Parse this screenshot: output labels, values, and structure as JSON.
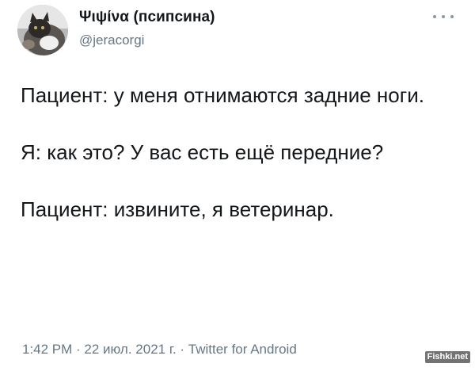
{
  "author": {
    "display_name": "Ψιψίνα (псипсина)",
    "handle": "@jeracorgi"
  },
  "tweet": {
    "paragraphs": [
      "Пациент: у меня отнимаются задние ноги.",
      "Я: как это? У вас есть ещё передние?",
      "Пациент: извините, я ветеринар."
    ],
    "timestamp": "1:42 PM · 22 июл. 2021 г. · Twitter for Android"
  },
  "icons": {
    "more": "more-horizontal-icon",
    "avatar": "cat-avatar"
  },
  "colors": {
    "text": "#14171a",
    "secondary": "#657786"
  },
  "watermark": "Fishki.net"
}
